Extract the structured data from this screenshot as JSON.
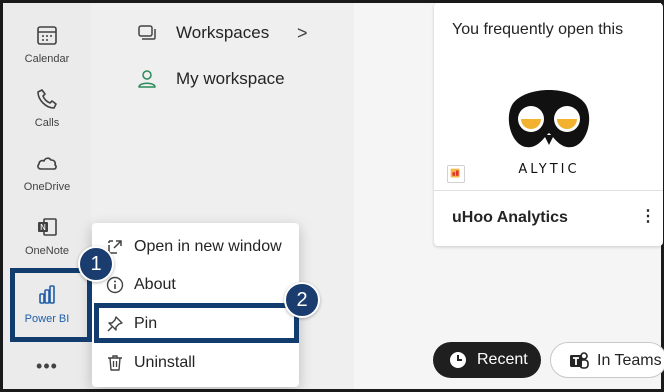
{
  "rail": {
    "items": [
      {
        "label": "Calendar",
        "icon": "calendar-icon"
      },
      {
        "label": "Calls",
        "icon": "phone-icon"
      },
      {
        "label": "OneDrive",
        "icon": "cloud-icon"
      },
      {
        "label": "OneNote",
        "icon": "onenote-icon"
      },
      {
        "label": "Power BI",
        "icon": "power-bi-icon",
        "selected": true
      }
    ],
    "more_label": "•••"
  },
  "subpanel": {
    "items": [
      {
        "label": "Workspaces",
        "icon": "workspaces-icon",
        "chevron": ">"
      },
      {
        "label": "My workspace",
        "icon": "person-icon"
      }
    ]
  },
  "card": {
    "hint": "You frequently open this",
    "logo_text": "ALYTIC",
    "title": "uHoo Analytics",
    "more": "⋮"
  },
  "filters": {
    "recent": "Recent",
    "in_teams": "In Teams"
  },
  "context_menu": {
    "items": [
      {
        "label": "Open in new window",
        "icon": "open-external-icon"
      },
      {
        "label": "About",
        "icon": "info-icon"
      },
      {
        "label": "Pin",
        "icon": "pin-icon"
      },
      {
        "label": "Uninstall",
        "icon": "trash-icon"
      }
    ]
  },
  "steps": {
    "one": "1",
    "two": "2"
  },
  "colors": {
    "highlight": "#133c6e",
    "power_bi_label": "#1f5fa8",
    "owl_eye": "#f2b230"
  }
}
